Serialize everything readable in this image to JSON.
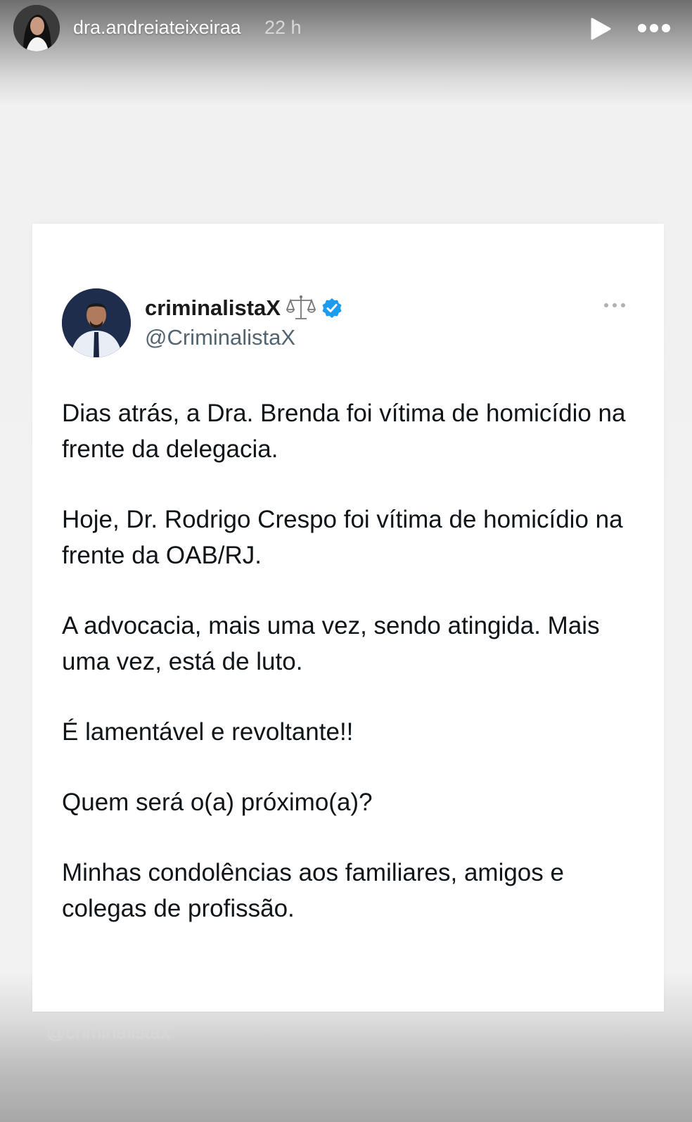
{
  "story": {
    "username": "dra.andreiateixeiraa",
    "time": "22 h",
    "icons": {
      "avatar": "profile-photo",
      "play": "play-icon",
      "more": "more-icon"
    }
  },
  "tweet": {
    "display_name": "criminalistaX",
    "handle": "@CriminalistaX",
    "icons": {
      "scales": "scales-icon",
      "verified": "verified-badge-icon",
      "more": "more-horizontal-icon"
    },
    "colors": {
      "verified": "#1d9bf0",
      "handle": "#536471",
      "text": "#0f1419"
    },
    "paragraphs": [
      "Dias atrás, a Dra. Brenda foi vítima de homicídio na frente da delegacia.",
      "Hoje, Dr. Rodrigo Crespo foi vítima de homicídio na frente da OAB/RJ.",
      "A advocacia, mais uma vez, sendo atingida. Mais uma vez, está de luto.",
      "É lamentável e revoltante!!",
      "Quem será o(a) próximo(a)?",
      "Minhas condolências aos familiares, amigos e colegas de profissão."
    ]
  },
  "watermark": "@criminalistax"
}
